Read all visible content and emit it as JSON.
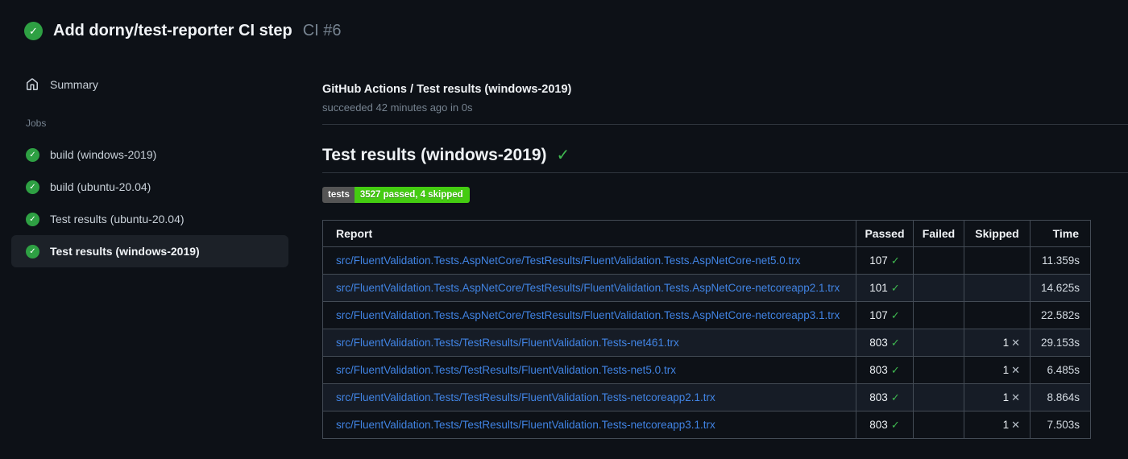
{
  "theme": {
    "page_bg": "#0d1117",
    "success_green": "#2ea043",
    "check_green": "#3fb950",
    "link_blue": "#4184e4",
    "border": "#434b55",
    "row_alt_bg": "#161c26",
    "badge_label_bg": "#555555",
    "badge_value_bg": "#44cc11"
  },
  "icons": {
    "check": "✓",
    "cross": "✕"
  },
  "header": {
    "status_icon": "success-check",
    "title": "Add dorny/test-reporter CI step",
    "run_number": "CI #6"
  },
  "sidebar": {
    "summary_label": "Summary",
    "jobs_label": "Jobs",
    "jobs": [
      {
        "label": "build (windows-2019)",
        "status": "success",
        "selected": false
      },
      {
        "label": "build (ubuntu-20.04)",
        "status": "success",
        "selected": false
      },
      {
        "label": "Test results (ubuntu-20.04)",
        "status": "success",
        "selected": false
      },
      {
        "label": "Test results (windows-2019)",
        "status": "success",
        "selected": true
      }
    ]
  },
  "main": {
    "check_title": "GitHub Actions / Test results (windows-2019)",
    "check_status": "succeeded 42 minutes ago in 0s",
    "section_title": "Test results (windows-2019)",
    "badge": {
      "label": "tests",
      "value": "3527 passed, 4 skipped"
    },
    "table": {
      "columns": [
        "Report",
        "Passed",
        "Failed",
        "Skipped",
        "Time"
      ],
      "rows": [
        {
          "report": "src/FluentValidation.Tests.AspNetCore/TestResults/FluentValidation.Tests.AspNetCore-net5.0.trx",
          "passed": "107",
          "failed": "",
          "skipped": "",
          "time": "11.359s"
        },
        {
          "report": "src/FluentValidation.Tests.AspNetCore/TestResults/FluentValidation.Tests.AspNetCore-netcoreapp2.1.trx",
          "passed": "101",
          "failed": "",
          "skipped": "",
          "time": "14.625s"
        },
        {
          "report": "src/FluentValidation.Tests.AspNetCore/TestResults/FluentValidation.Tests.AspNetCore-netcoreapp3.1.trx",
          "passed": "107",
          "failed": "",
          "skipped": "",
          "time": "22.582s"
        },
        {
          "report": "src/FluentValidation.Tests/TestResults/FluentValidation.Tests-net461.trx",
          "passed": "803",
          "failed": "",
          "skipped": "1",
          "time": "29.153s"
        },
        {
          "report": "src/FluentValidation.Tests/TestResults/FluentValidation.Tests-net5.0.trx",
          "passed": "803",
          "failed": "",
          "skipped": "1",
          "time": "6.485s"
        },
        {
          "report": "src/FluentValidation.Tests/TestResults/FluentValidation.Tests-netcoreapp2.1.trx",
          "passed": "803",
          "failed": "",
          "skipped": "1",
          "time": "8.864s"
        },
        {
          "report": "src/FluentValidation.Tests/TestResults/FluentValidation.Tests-netcoreapp3.1.trx",
          "passed": "803",
          "failed": "",
          "skipped": "1",
          "time": "7.503s"
        }
      ]
    }
  }
}
